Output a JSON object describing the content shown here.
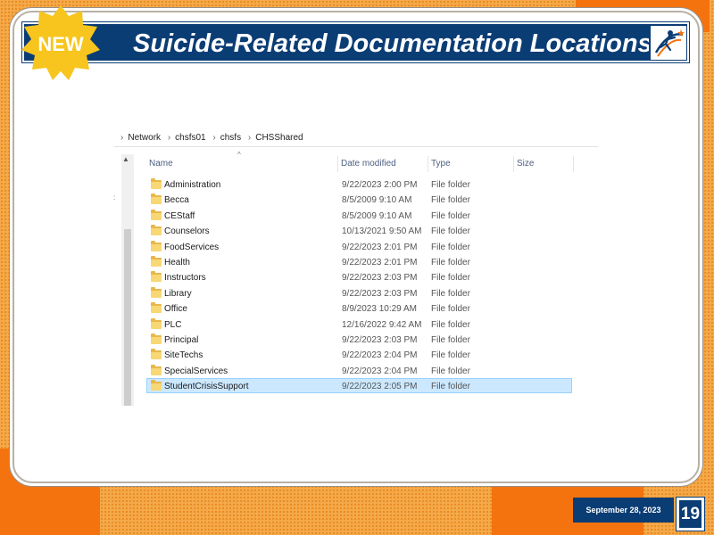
{
  "slide": {
    "title": "Suicide-Related Documentation Locations",
    "badge": "NEW",
    "date": "September 28, 2023",
    "page_number": "19",
    "colors": {
      "navy": "#0b3d75",
      "orange": "#f4730f",
      "badge_yellow": "#f7c51d"
    }
  },
  "explorer": {
    "breadcrumb": [
      "Network",
      "chsfs01",
      "chsfs",
      "CHSShared"
    ],
    "columns": {
      "name": "Name",
      "date": "Date modified",
      "type": "Type",
      "size": "Size"
    },
    "rows": [
      {
        "name": "Administration",
        "date": "9/22/2023 2:00 PM",
        "type": "File folder"
      },
      {
        "name": "Becca",
        "date": "8/5/2009 9:10 AM",
        "type": "File folder"
      },
      {
        "name": "CEStaff",
        "date": "8/5/2009 9:10 AM",
        "type": "File folder"
      },
      {
        "name": "Counselors",
        "date": "10/13/2021 9:50 AM",
        "type": "File folder"
      },
      {
        "name": "FoodServices",
        "date": "9/22/2023 2:01 PM",
        "type": "File folder"
      },
      {
        "name": "Health",
        "date": "9/22/2023 2:01 PM",
        "type": "File folder"
      },
      {
        "name": "Instructors",
        "date": "9/22/2023 2:03 PM",
        "type": "File folder"
      },
      {
        "name": "Library",
        "date": "9/22/2023 2:03 PM",
        "type": "File folder"
      },
      {
        "name": "Office",
        "date": "8/9/2023 10:29 AM",
        "type": "File folder"
      },
      {
        "name": "PLC",
        "date": "12/16/2022 9:42 AM",
        "type": "File folder"
      },
      {
        "name": "Principal",
        "date": "9/22/2023 2:03 PM",
        "type": "File folder"
      },
      {
        "name": "SiteTechs",
        "date": "9/22/2023 2:04 PM",
        "type": "File folder"
      },
      {
        "name": "SpecialServices",
        "date": "9/22/2023 2:04 PM",
        "type": "File folder"
      },
      {
        "name": "StudentCrisisSupport",
        "date": "9/22/2023 2:05 PM",
        "type": "File folder",
        "selected": true
      }
    ]
  }
}
